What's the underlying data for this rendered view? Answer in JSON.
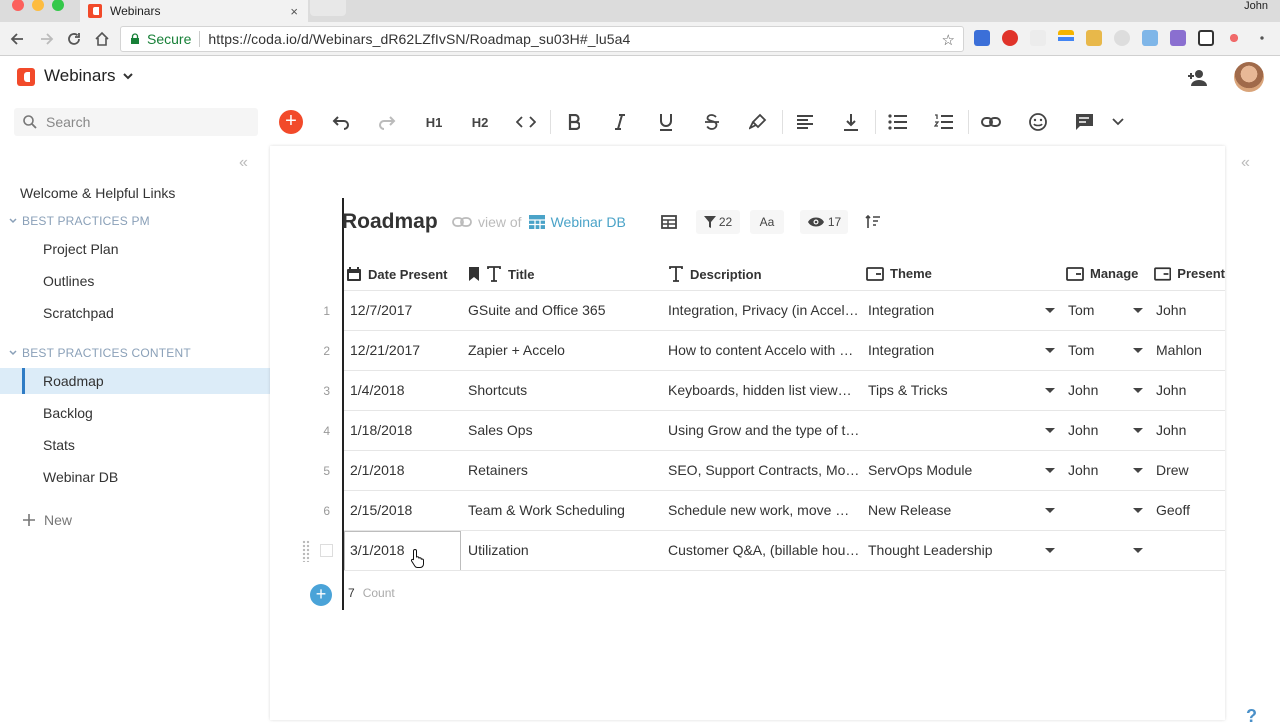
{
  "browser": {
    "tab_title": "Webinars",
    "tab_close": "×",
    "profile": "John",
    "secure_label": "Secure",
    "url": "https://coda.io/d/Webinars_dR62LZfIvSN/Roadmap_su03H#_lu5a4"
  },
  "header": {
    "doc_title": "Webinars"
  },
  "sidebar": {
    "search_placeholder": "Search",
    "top_item": "Welcome & Helpful Links",
    "section1": "BEST PRACTICES PM",
    "section1_items": [
      "Project Plan",
      "Outlines",
      "Scratchpad"
    ],
    "section2": "BEST PRACTICES CONTENT",
    "section2_items": [
      "Roadmap",
      "Backlog",
      "Stats",
      "Webinar DB"
    ],
    "new_label": "New"
  },
  "toolbar": {
    "h1": "H1",
    "h2": "H2"
  },
  "table": {
    "title": "Roadmap",
    "view_of": "view of",
    "source": "Webinar DB",
    "filter_count": "22",
    "text_toggle": "Aa",
    "visible_count": "17",
    "columns": [
      "Date Present",
      "Title",
      "Description",
      "Theme",
      "Manage",
      "Present"
    ],
    "rows": [
      {
        "num": "1",
        "date": "12/7/2017",
        "title": "GSuite and Office 365",
        "description": "Integration, Privacy (in Accel…",
        "theme": "Integration",
        "manager": "Tom",
        "presenter": "John"
      },
      {
        "num": "2",
        "date": "12/21/2017",
        "title": "Zapier + Accelo",
        "description": "How to content Accelo with …",
        "theme": "Integration",
        "manager": "Tom",
        "presenter": "Mahlon"
      },
      {
        "num": "3",
        "date": "1/4/2018",
        "title": "Shortcuts",
        "description": "Keyboards, hidden list view…",
        "theme": "Tips & Tricks",
        "manager": "John",
        "presenter": "John"
      },
      {
        "num": "4",
        "date": "1/18/2018",
        "title": "Sales Ops",
        "description": "Using Grow and the type of t…",
        "theme": "",
        "manager": "John",
        "presenter": "John"
      },
      {
        "num": "5",
        "date": "2/1/2018",
        "title": "Retainers",
        "description": "SEO, Support Contracts, Mo…",
        "theme": "ServOps Module",
        "manager": "John",
        "presenter": "Drew"
      },
      {
        "num": "6",
        "date": "2/15/2018",
        "title": "Team & Work Scheduling",
        "description": "Schedule new work, move …",
        "theme": "New Release",
        "manager": "",
        "presenter": "Geoff"
      },
      {
        "num": "",
        "date": "3/1/2018",
        "title": "Utilization",
        "description": "Customer Q&A, (billable hou…",
        "theme": "Thought Leadership",
        "manager": "",
        "presenter": ""
      }
    ],
    "count_value": "7",
    "count_label": "Count"
  },
  "colors": {
    "brand": "#f24a2a",
    "accent": "#4aa3d8",
    "selected_nav": "#dcecf8"
  }
}
